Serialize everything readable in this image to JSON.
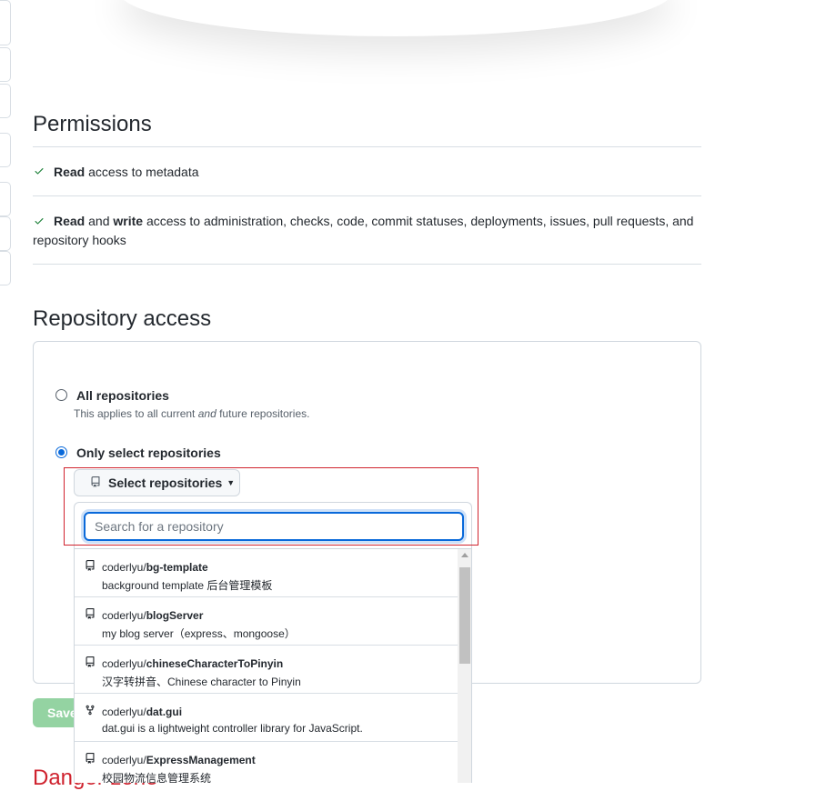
{
  "permissions": {
    "title": "Permissions",
    "items": [
      {
        "parts": [
          [
            "b",
            "Read"
          ],
          [
            "t",
            " access to metadata"
          ]
        ]
      },
      {
        "parts": [
          [
            "b",
            "Read"
          ],
          [
            "t",
            " and "
          ],
          [
            "b",
            "write"
          ],
          [
            "t",
            " access to administration, checks, code, commit statuses, deployments, issues, pull requests, and repository hooks"
          ]
        ]
      }
    ]
  },
  "repository_access": {
    "title": "Repository access",
    "all_label": "All repositories",
    "all_note_before": "This applies to all current ",
    "all_note_em": "and",
    "all_note_after": " future repositories.",
    "only_label": "Only select repositories",
    "select_button": "Select repositories",
    "search_placeholder": "Search for a repository",
    "repos": [
      {
        "owner": "coderlyu/",
        "name": "bg-template",
        "desc": "background template 后台管理模板",
        "icon": "repo-icon"
      },
      {
        "owner": "coderlyu/",
        "name": "blogServer",
        "desc": "my blog server（express、mongoose）",
        "icon": "repo-icon"
      },
      {
        "owner": "coderlyu/",
        "name": "chineseCharacterToPinyin",
        "desc": "汉字转拼音、Chinese character to Pinyin",
        "icon": "repo-icon"
      },
      {
        "owner": "coderlyu/",
        "name": "dat.gui",
        "desc": "dat.gui is a lightweight controller library for JavaScript.",
        "icon": "fork-icon"
      },
      {
        "owner": "coderlyu/",
        "name": "ExpressManagement",
        "desc": "校园物流信息管理系统",
        "icon": "repo-icon"
      }
    ]
  },
  "save_button": "Save",
  "danger_title": "Danger zone",
  "colors": {
    "accent": "#0969da",
    "success": "#1a7f37",
    "danger": "#cf222e",
    "highlight": "#d1242f"
  }
}
